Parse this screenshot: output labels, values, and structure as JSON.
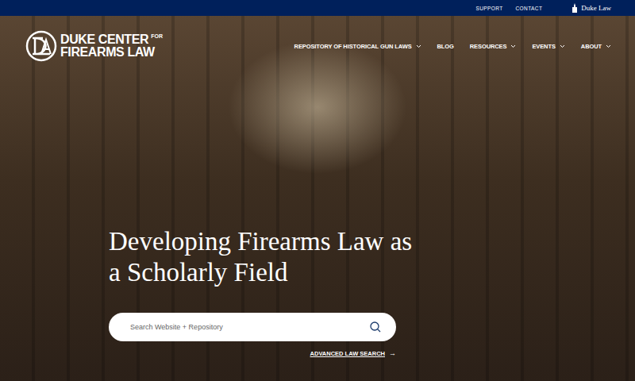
{
  "utility_bar": {
    "links": [
      "SUPPORT",
      "CONTACT"
    ],
    "brand": "Duke Law"
  },
  "logo": {
    "line1": "DUKE CENTER",
    "superscript": "FOR",
    "line2": "FIREARMS LAW"
  },
  "nav": [
    {
      "label": "REPOSITORY OF HISTORICAL GUN LAWS",
      "has_dropdown": true
    },
    {
      "label": "BLOG",
      "has_dropdown": false
    },
    {
      "label": "RESOURCES",
      "has_dropdown": true
    },
    {
      "label": "EVENTS",
      "has_dropdown": true
    },
    {
      "label": "ABOUT",
      "has_dropdown": true
    }
  ],
  "hero": {
    "title": "Developing Firearms Law as a Scholarly Field"
  },
  "search": {
    "placeholder": "Search Website + Repository"
  },
  "advanced_search": {
    "label": "ADVANCED LAW SEARCH",
    "arrow": "→"
  }
}
